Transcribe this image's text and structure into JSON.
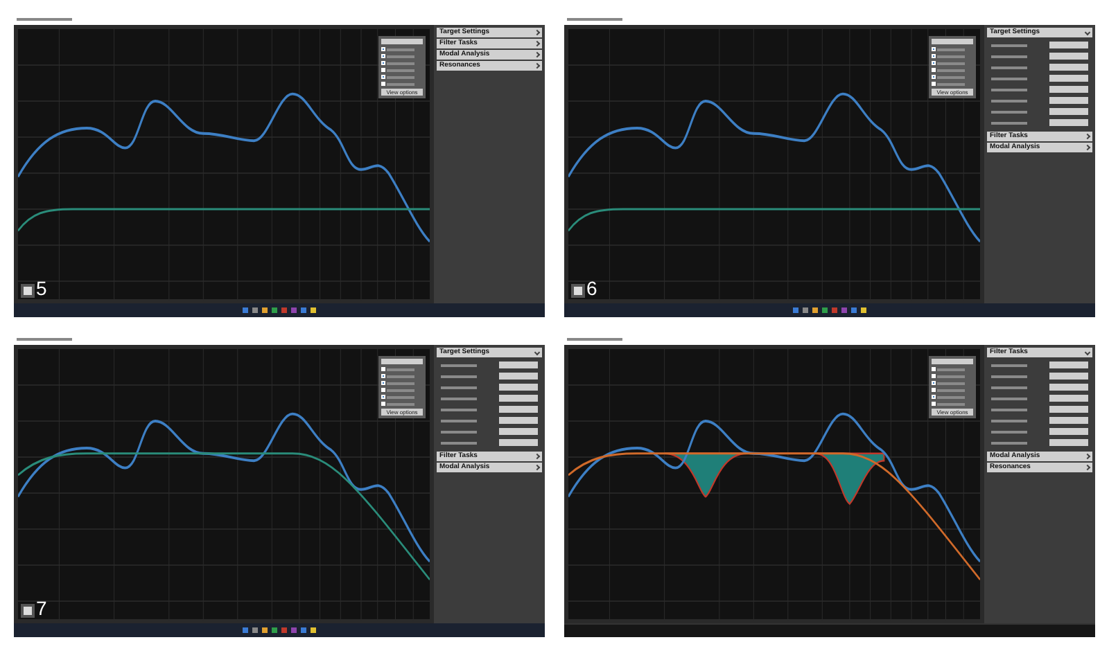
{
  "screens": [
    {
      "step": "5",
      "target": {
        "kind": "flat"
      },
      "eq_fill": false,
      "bottom_bar": {
        "kind": "taskbar"
      },
      "options": [
        {
          "checked": true
        },
        {
          "checked": true
        },
        {
          "checked": true
        },
        {
          "checked": false
        },
        {
          "checked": true
        },
        {
          "checked": false
        }
      ],
      "sections": [
        {
          "title": "Target Settings",
          "expanded": false
        },
        {
          "title": "Filter Tasks",
          "expanded": false
        },
        {
          "title": "Modal Analysis",
          "expanded": false
        },
        {
          "title": "Resonances",
          "expanded": false
        }
      ],
      "options_button": "View options"
    },
    {
      "step": "6",
      "target": {
        "kind": "flat"
      },
      "eq_fill": false,
      "bottom_bar": {
        "kind": "taskbar"
      },
      "options": [
        {
          "checked": true
        },
        {
          "checked": true
        },
        {
          "checked": true
        },
        {
          "checked": false
        },
        {
          "checked": true
        },
        {
          "checked": false
        }
      ],
      "sections": [
        {
          "title": "Target Settings",
          "expanded": true
        },
        {
          "title": "Filter Tasks",
          "expanded": false
        },
        {
          "title": "Modal Analysis",
          "expanded": false
        }
      ],
      "options_button": "View options"
    },
    {
      "step": "7",
      "target": {
        "kind": "rolloff"
      },
      "eq_fill": false,
      "bottom_bar": {
        "kind": "taskbar"
      },
      "options": [
        {
          "checked": false
        },
        {
          "checked": true
        },
        {
          "checked": true
        },
        {
          "checked": false
        },
        {
          "checked": true
        },
        {
          "checked": false
        }
      ],
      "sections": [
        {
          "title": "Target Settings",
          "expanded": true
        },
        {
          "title": "Filter Tasks",
          "expanded": false
        },
        {
          "title": "Modal Analysis",
          "expanded": false
        }
      ],
      "options_button": "View options"
    },
    {
      "target": {
        "kind": "rolloff"
      },
      "eq_fill": true,
      "bottom_bar": {
        "kind": "legend"
      },
      "options": [
        {
          "checked": false
        },
        {
          "checked": false
        },
        {
          "checked": true
        },
        {
          "checked": false
        },
        {
          "checked": true
        },
        {
          "checked": false
        }
      ],
      "sections": [
        {
          "title": "Filter Tasks",
          "expanded": true
        },
        {
          "title": "Modal Analysis",
          "expanded": false
        },
        {
          "title": "Resonances",
          "expanded": false
        }
      ],
      "options_button": "View options"
    }
  ]
}
